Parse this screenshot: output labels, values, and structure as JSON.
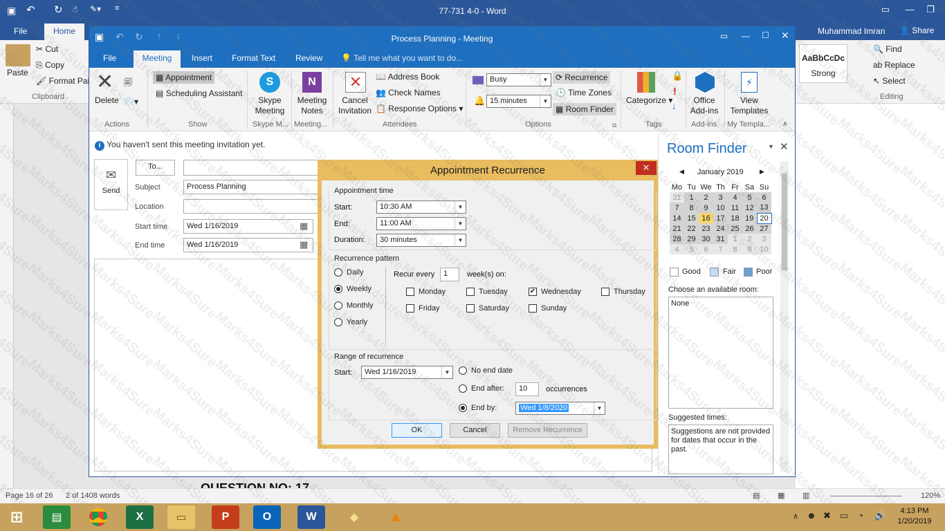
{
  "word": {
    "title": "77-731 4-0 - Word",
    "qat": [
      "↶",
      "↻"
    ],
    "tabs": [
      "File",
      "Home"
    ],
    "user": "Muhammad Imran",
    "share": "Share",
    "clipboard": {
      "paste": "Paste",
      "cut": "Cut",
      "copy": "Copy",
      "format_painter": "Format Pai",
      "group": "Clipboard"
    },
    "styles": {
      "sample": "AaBbCcDc",
      "name": "Strong"
    },
    "editing": {
      "find": "Find",
      "replace": "Replace",
      "select": "Select",
      "group": "Editing"
    },
    "doc_text": "QUESTION NO: 17",
    "status": {
      "page": "Page 16 of 26",
      "words": "2 of 1408 words",
      "zoom": "120%"
    }
  },
  "outlook": {
    "title": "Process Planning - Meeting",
    "tabs": [
      "File",
      "Meeting",
      "Insert",
      "Format Text",
      "Review"
    ],
    "tell_me": "Tell me what you want to do...",
    "ribbon": {
      "delete": "Delete",
      "actions": "Actions",
      "appointment": "Appointment",
      "scheduling": "Scheduling Assistant",
      "show": "Show",
      "skype_meeting": "Skype Meeting",
      "skype_group": "Skype M...",
      "meeting_notes": "Meeting Notes",
      "notes_group": "Meeting...",
      "cancel_invitation": "Cancel Invitation",
      "address_book": "Address Book",
      "check_names": "Check Names",
      "response_options": "Response Options",
      "attendees": "Attendees",
      "show_as": "Busy",
      "reminder": "15 minutes",
      "recurrence": "Recurrence",
      "time_zones": "Time Zones",
      "room_finder": "Room Finder",
      "options": "Options",
      "categorize": "Categorize",
      "tags": "Tags",
      "office_addins": "Office Add-ins",
      "addins": "Add-ins",
      "view_templates": "View Templates",
      "my_templates": "My Templa..."
    },
    "info_bar": "You haven't sent this meeting invitation yet.",
    "form": {
      "send": "Send",
      "to": "To...",
      "subject_label": "Subject",
      "subject": "Process Planning",
      "location_label": "Location",
      "start_label": "Start time",
      "start": "Wed 1/16/2019",
      "end_label": "End time",
      "end": "Wed 1/16/2019"
    }
  },
  "dialog": {
    "title": "Appointment Recurrence",
    "appt_time": "Appointment time",
    "start_label": "Start:",
    "start": "10:30 AM",
    "end_label": "End:",
    "end": "11:00 AM",
    "duration_label": "Duration:",
    "duration": "30 minutes",
    "pattern": "Recurrence pattern",
    "daily": "Daily",
    "weekly": "Weekly",
    "monthly": "Monthly",
    "yearly": "Yearly",
    "recur_every": "Recur every",
    "recur_value": "1",
    "weeks_on": "week(s) on:",
    "days": {
      "monday": "Monday",
      "tuesday": "Tuesday",
      "wednesday": "Wednesday",
      "thursday": "Thursday",
      "friday": "Friday",
      "saturday": "Saturday",
      "sunday": "Sunday"
    },
    "range": "Range of recurrence",
    "range_start_label": "Start:",
    "range_start": "Wed 1/16/2019",
    "no_end": "No end date",
    "end_after": "End after:",
    "end_after_value": "10",
    "occurrences": "occurrences",
    "end_by": "End by:",
    "end_by_value": "Wed 1/8/2020",
    "ok": "OK",
    "cancel": "Cancel",
    "remove": "Remove Recurrence"
  },
  "room_finder": {
    "title": "Room Finder",
    "month": "January 2019",
    "dow": [
      "Mo",
      "Tu",
      "We",
      "Th",
      "Fr",
      "Sa",
      "Su"
    ],
    "weeks": [
      [
        "31",
        "1",
        "2",
        "3",
        "4",
        "5",
        "6"
      ],
      [
        "7",
        "8",
        "9",
        "10",
        "11",
        "12",
        "13"
      ],
      [
        "14",
        "15",
        "16",
        "17",
        "18",
        "19",
        "20"
      ],
      [
        "21",
        "22",
        "23",
        "24",
        "25",
        "26",
        "27"
      ],
      [
        "28",
        "29",
        "30",
        "31",
        "1",
        "2",
        "3"
      ],
      [
        "4",
        "5",
        "6",
        "7",
        "8",
        "9",
        "10"
      ]
    ],
    "good": "Good",
    "fair": "Fair",
    "poor": "Poor",
    "choose_room": "Choose an available room:",
    "room_none": "None",
    "suggested": "Suggested times:",
    "suggestion_text": "Suggestions are not provided for dates that occur in the past."
  },
  "taskbar": {
    "time": "4:13 PM",
    "date": "1/20/2019"
  },
  "watermark": "Marks4Sure",
  "colors": {
    "outlook_blue": "#1e6fc0",
    "word_blue": "#2b579a",
    "dialog_border": "#e8bc5f",
    "close_red": "#c42b1c"
  }
}
